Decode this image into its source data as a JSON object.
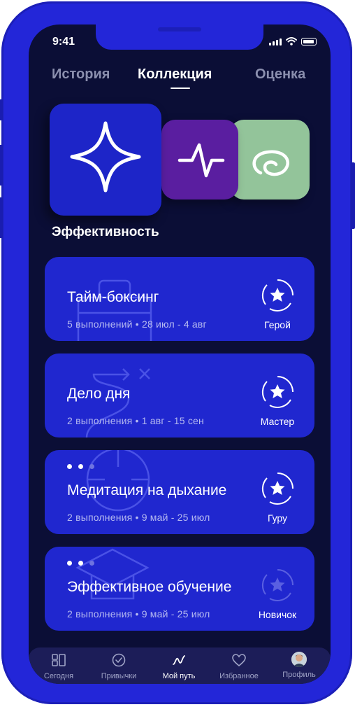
{
  "status_bar": {
    "time": "9:41"
  },
  "tabs": [
    {
      "label": "История",
      "active": false
    },
    {
      "label": "Коллекция",
      "active": true
    },
    {
      "label": "Оценка",
      "active": false
    }
  ],
  "section": {
    "title": "Эффективность"
  },
  "hero_icons": [
    {
      "icon": "sparkle-star-icon",
      "color": "#1d25c8"
    },
    {
      "icon": "pulse-icon",
      "color": "#5a1ea0"
    },
    {
      "icon": "spiral-icon",
      "color": "#93c49a"
    }
  ],
  "cards": [
    {
      "title": "Тайм-боксинг",
      "meta": "5 выполнений • 28 июл - 4 авг",
      "badge": "Герой",
      "badge_icon": "star-badge-icon",
      "deco_icon": "briefcase-icon"
    },
    {
      "title": "Дело дня",
      "meta": "2 выполнения • 1 авг - 15 сен",
      "badge": "Мастер",
      "badge_icon": "star-badge-icon",
      "deco_icon": "path-cross-icon"
    },
    {
      "title": "Медитация на дыхание",
      "meta": "2 выполнения • 9 май - 25 июл",
      "badge": "Гуру",
      "badge_icon": "star-badge-icon",
      "deco_icon": "target-icon"
    },
    {
      "title": "Эффективное обучение",
      "meta": "2 выполнения • 9 май - 25 июл",
      "badge": "Новичок",
      "badge_icon": "star-badge-icon",
      "deco_icon": "graduation-cap-icon"
    }
  ],
  "nav": [
    {
      "label": "Сегодня",
      "icon": "today-grid-icon",
      "active": false
    },
    {
      "label": "Привычки",
      "icon": "check-circle-icon",
      "active": false
    },
    {
      "label": "Мой путь",
      "icon": "path-icon",
      "active": true
    },
    {
      "label": "Избранное",
      "icon": "heart-icon",
      "active": false
    },
    {
      "label": "Профиль",
      "icon": "avatar",
      "active": false
    }
  ],
  "colors": {
    "frame": "#2326d8",
    "screen_bg": "#0b0e36",
    "card_bg": "#2027cf",
    "nav_bg": "#1c1d58"
  }
}
